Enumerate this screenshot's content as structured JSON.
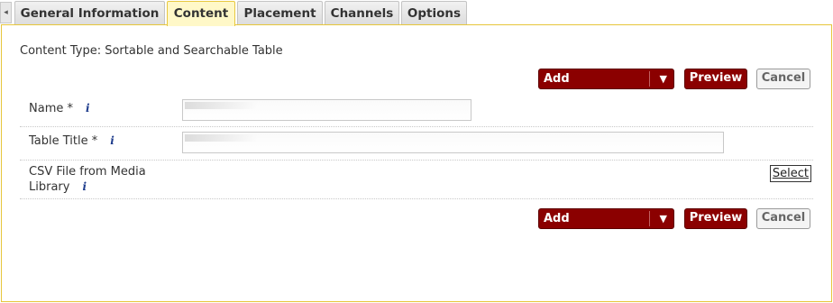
{
  "tabs": [
    {
      "label": "General Information",
      "active": false
    },
    {
      "label": "Content",
      "active": true
    },
    {
      "label": "Placement",
      "active": false
    },
    {
      "label": "Channels",
      "active": false
    },
    {
      "label": "Options",
      "active": false
    }
  ],
  "content_type": "Content Type: Sortable and Searchable Table",
  "toolbar": {
    "add_label": "Add",
    "add_arrow": "▼",
    "preview_label": "Preview",
    "cancel_label": "Cancel"
  },
  "fields": {
    "name": {
      "label": "Name *",
      "info": "i",
      "value": ""
    },
    "table_title": {
      "label": "Table Title *",
      "info": "i",
      "value": ""
    },
    "csv_file": {
      "label_line1": "CSV File from Media",
      "label_line2": "Library",
      "info": "i",
      "select_label": "Select"
    }
  },
  "colors": {
    "accent": "#8b0000",
    "active_tab": "#fff8c8",
    "panel_border": "#e6c63a",
    "info_icon": "#1e3c8c"
  }
}
